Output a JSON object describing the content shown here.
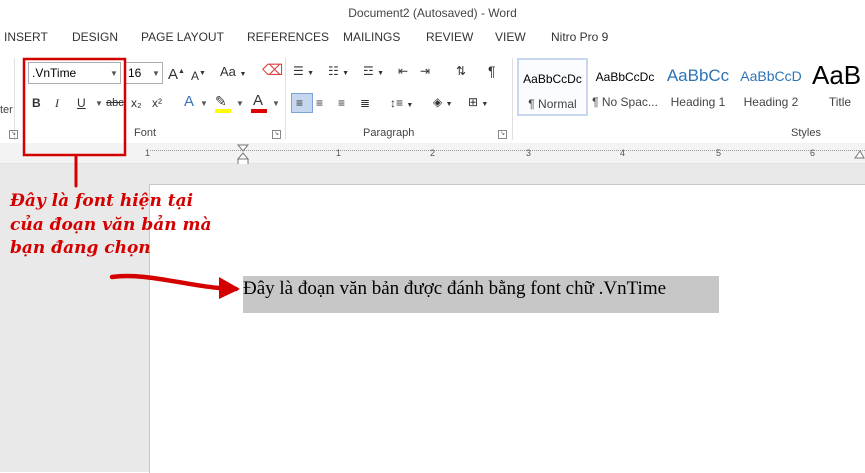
{
  "window": {
    "title": "Document2 (Autosaved) - Word"
  },
  "tabs": [
    "INSERT",
    "DESIGN",
    "PAGE LAYOUT",
    "REFERENCES",
    "MAILINGS",
    "REVIEW",
    "VIEW",
    "Nitro Pro 9"
  ],
  "ribbon": {
    "left_cut_label": "ter",
    "font": {
      "group_label": "Font",
      "font_name": ".VnTime",
      "font_size": "16",
      "grow_label": "A",
      "shrink_label": "A",
      "change_case_label": "Aa",
      "bold_label": "B",
      "italic_label": "I",
      "underline_label": "U",
      "strike_label": "abc",
      "subscript_label": "x₂",
      "superscript_label": "x²",
      "effects_label": "A",
      "font_color_label": "A"
    },
    "paragraph": {
      "group_label": "Paragraph"
    },
    "styles": {
      "group_label": "Styles",
      "items": [
        {
          "preview": "AaBbCcDc",
          "name": "¶ Normal"
        },
        {
          "preview": "AaBbCcDc",
          "name": "¶ No Spac..."
        },
        {
          "preview": "AaBbCc",
          "name": "Heading 1"
        },
        {
          "preview": "AaBbCcD",
          "name": "Heading 2"
        },
        {
          "preview": "AaB",
          "name": "Title"
        }
      ]
    }
  },
  "ruler": {
    "numbers": [
      "1",
      "1",
      "2",
      "3",
      "4",
      "5",
      "6"
    ]
  },
  "document": {
    "text": "Đây là đoạn văn bản được đánh bằng font chữ .VnTime"
  },
  "annotation": {
    "lines": [
      "Đây là font hiện tại",
      "của đoạn văn bản mà",
      "bạn đang chọn"
    ],
    "color": "#d40000"
  },
  "colors": {
    "highlight": "#ffff00",
    "font_color": "#e00000",
    "accent": "#2b579a"
  }
}
